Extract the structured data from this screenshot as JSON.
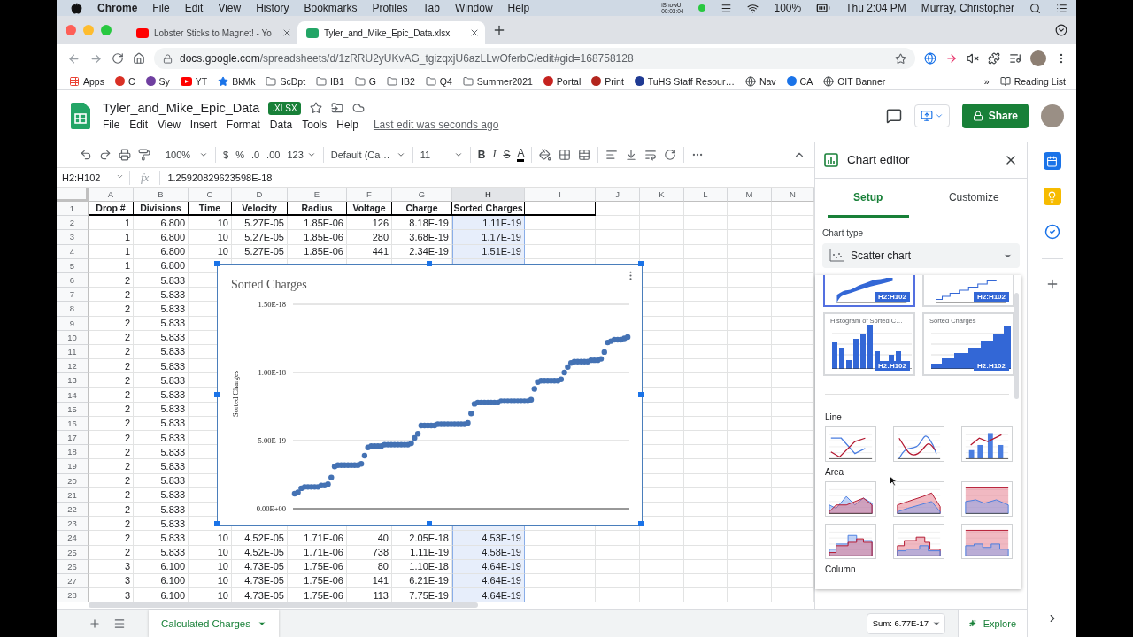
{
  "menubar": {
    "app": "Chrome",
    "items": [
      "File",
      "Edit",
      "View",
      "History",
      "Bookmarks",
      "Profiles",
      "Tab",
      "Window",
      "Help"
    ],
    "recorder": "iShowU",
    "recorder_time": "00:03:04",
    "battery": "100%",
    "clock": "Thu 2:04 PM",
    "user": "Murray, Christopher"
  },
  "browser_tabs": [
    {
      "title": "Lobster Sticks to Magnet! - Yo",
      "kind": "video",
      "selected": false
    },
    {
      "title": "Tyler_and_Mike_Epic_Data.xlsx",
      "kind": "sheet",
      "selected": true
    }
  ],
  "address": {
    "host": "docs.google.com",
    "path": "/spreadsheets/d/1zRRU2yUKvAG_tgizqxjU6azLLwOferbC/edit#gid=168758128"
  },
  "bookmarks": [
    {
      "kind": "apps",
      "label": "Apps"
    },
    {
      "kind": "site",
      "label": "C",
      "color": "#d93025"
    },
    {
      "kind": "site",
      "label": "Sy",
      "color": "#6f3fa0"
    },
    {
      "kind": "video",
      "label": "YT"
    },
    {
      "kind": "star",
      "label": "BkMk"
    },
    {
      "kind": "folder",
      "label": "ScDpt"
    },
    {
      "kind": "folder",
      "label": "IB1"
    },
    {
      "kind": "folder",
      "label": "G"
    },
    {
      "kind": "folder",
      "label": "IB2"
    },
    {
      "kind": "folder",
      "label": "Q4"
    },
    {
      "kind": "folder",
      "label": "Summer2021"
    },
    {
      "kind": "site",
      "label": "Portal",
      "color": "#c5221f"
    },
    {
      "kind": "site",
      "label": "Print",
      "color": "#b3261e"
    },
    {
      "kind": "site",
      "label": "TuHS Staff Resour…",
      "color": "#1f3a93"
    },
    {
      "kind": "globe",
      "label": "Nav"
    },
    {
      "kind": "site",
      "label": "CA",
      "color": "#1a73e8"
    },
    {
      "kind": "globe",
      "label": "OIT Banner"
    }
  ],
  "more_bookmarks": "»",
  "reading_list": "Reading List",
  "doc": {
    "title": "Tyler_and_Mike_Epic_Data",
    "badge": ".XLSX",
    "menu": [
      "File",
      "Edit",
      "View",
      "Insert",
      "Format",
      "Data",
      "Tools",
      "Help"
    ],
    "last_edit": "Last edit was seconds ago",
    "share": "Share"
  },
  "toolbar": {
    "zoom": "100%",
    "currency": "$",
    "percent": "%",
    "decrease_decimals": ".0",
    "increase_decimals": ".00",
    "number_format": "123",
    "font": "Default (Ca…",
    "font_size": "11",
    "bold": "B",
    "italic": "I",
    "strikethrough": "S",
    "text_color": "A"
  },
  "formula_bar": {
    "range": "H2:H102",
    "fx": "fx",
    "value": "1.25920829623598E-18"
  },
  "columns": [
    {
      "label": "A",
      "selected": false
    },
    {
      "label": "B",
      "selected": false
    },
    {
      "label": "C",
      "selected": false
    },
    {
      "label": "D",
      "selected": false
    },
    {
      "label": "E",
      "selected": false
    },
    {
      "label": "F",
      "selected": false
    },
    {
      "label": "G",
      "selected": false
    },
    {
      "label": "H",
      "selected": true
    },
    {
      "label": "I",
      "selected": false
    },
    {
      "label": "J",
      "selected": false
    },
    {
      "label": "K",
      "selected": false
    },
    {
      "label": "L",
      "selected": false
    },
    {
      "label": "M",
      "selected": false
    },
    {
      "label": "N",
      "selected": false
    }
  ],
  "rows": [
    {
      "n": "1",
      "kind": "header",
      "cells": [
        "Drop #",
        "Divisions",
        "Time",
        "Velocity",
        "Radius",
        "Voltage",
        "Charge",
        "Sorted Charges"
      ]
    },
    {
      "n": "2",
      "kind": "data",
      "cells": [
        "1",
        "6.800",
        "10",
        "5.27E-05",
        "1.85E-06",
        "126",
        "8.18E-19",
        "1.11E-19"
      ]
    },
    {
      "n": "3",
      "kind": "data",
      "cells": [
        "1",
        "6.800",
        "10",
        "5.27E-05",
        "1.85E-06",
        "280",
        "3.68E-19",
        "1.17E-19"
      ]
    },
    {
      "n": "4",
      "kind": "data",
      "cells": [
        "1",
        "6.800",
        "10",
        "5.27E-05",
        "1.85E-06",
        "441",
        "2.34E-19",
        "1.51E-19"
      ]
    },
    {
      "n": "5",
      "kind": "data",
      "cells": [
        "1",
        "6.800"
      ]
    },
    {
      "n": "6",
      "kind": "data",
      "cells": [
        "2",
        "5.833"
      ]
    },
    {
      "n": "7",
      "kind": "data",
      "cells": [
        "2",
        "5.833"
      ]
    },
    {
      "n": "8",
      "kind": "data",
      "cells": [
        "2",
        "5.833"
      ]
    },
    {
      "n": "9",
      "kind": "data",
      "cells": [
        "2",
        "5.833"
      ]
    },
    {
      "n": "10",
      "kind": "data",
      "cells": [
        "2",
        "5.833"
      ]
    },
    {
      "n": "11",
      "kind": "data",
      "cells": [
        "2",
        "5.833"
      ]
    },
    {
      "n": "12",
      "kind": "data",
      "cells": [
        "2",
        "5.833"
      ]
    },
    {
      "n": "13",
      "kind": "data",
      "cells": [
        "2",
        "5.833"
      ]
    },
    {
      "n": "14",
      "kind": "data",
      "cells": [
        "2",
        "5.833"
      ]
    },
    {
      "n": "15",
      "kind": "data",
      "cells": [
        "2",
        "5.833"
      ]
    },
    {
      "n": "16",
      "kind": "data",
      "cells": [
        "2",
        "5.833"
      ]
    },
    {
      "n": "17",
      "kind": "data",
      "cells": [
        "2",
        "5.833"
      ]
    },
    {
      "n": "18",
      "kind": "data",
      "cells": [
        "2",
        "5.833"
      ]
    },
    {
      "n": "19",
      "kind": "data",
      "cells": [
        "2",
        "5.833"
      ]
    },
    {
      "n": "20",
      "kind": "data",
      "cells": [
        "2",
        "5.833"
      ]
    },
    {
      "n": "21",
      "kind": "data",
      "cells": [
        "2",
        "5.833"
      ]
    },
    {
      "n": "22",
      "kind": "data",
      "cells": [
        "2",
        "5.833"
      ]
    },
    {
      "n": "23",
      "kind": "data",
      "cells": [
        "2",
        "5.833"
      ]
    },
    {
      "n": "24",
      "kind": "data",
      "cells": [
        "2",
        "5.833",
        "10",
        "4.52E-05",
        "1.71E-06",
        "40",
        "2.05E-18",
        "4.53E-19"
      ]
    },
    {
      "n": "25",
      "kind": "data",
      "cells": [
        "2",
        "5.833",
        "10",
        "4.52E-05",
        "1.71E-06",
        "738",
        "1.11E-19",
        "4.58E-19"
      ]
    },
    {
      "n": "26",
      "kind": "data",
      "cells": [
        "3",
        "6.100",
        "10",
        "4.73E-05",
        "1.75E-06",
        "80",
        "1.10E-18",
        "4.64E-19"
      ]
    },
    {
      "n": "27",
      "kind": "data",
      "cells": [
        "3",
        "6.100",
        "10",
        "4.73E-05",
        "1.75E-06",
        "141",
        "6.21E-19",
        "4.64E-19"
      ]
    },
    {
      "n": "28",
      "kind": "data",
      "cells": [
        "3",
        "6.100",
        "10",
        "4.73E-05",
        "1.75E-06",
        "113",
        "7.75E-19",
        "4.64E-19"
      ]
    }
  ],
  "chart": {
    "chart_data": {
      "type": "scatter",
      "title": "Sorted Charges",
      "ylabel": "Sorted Charges",
      "ylim": [
        0,
        1.5e-18
      ],
      "yticks": [
        {
          "value": 0,
          "label": "0.00E+00"
        },
        {
          "value": 5e-19,
          "label": "5.00E-19"
        },
        {
          "value": 1e-18,
          "label": "1.00E-18"
        },
        {
          "value": 1.5e-18,
          "label": "1.50E-18"
        }
      ],
      "categories": [
        null,
        null,
        null,
        null,
        null,
        null,
        null,
        null,
        null,
        null,
        null,
        null,
        null,
        null,
        null,
        null,
        null,
        null,
        null,
        null,
        null,
        null,
        null,
        null,
        null,
        null,
        null,
        null,
        null,
        null,
        null,
        null,
        null,
        null,
        null,
        null,
        null,
        null,
        null,
        null,
        null,
        null,
        null,
        null,
        null,
        null,
        null,
        null,
        null,
        null,
        null,
        null,
        null,
        null,
        null,
        null,
        null,
        null,
        null,
        null,
        null,
        null,
        null,
        null,
        null,
        null,
        null,
        null,
        null,
        null,
        null,
        null,
        null,
        null,
        null,
        null,
        null,
        null,
        null,
        null,
        null,
        null,
        null,
        null,
        null,
        null,
        null,
        null,
        null,
        null,
        null,
        null,
        null,
        null,
        null,
        null,
        null,
        null,
        null,
        null,
        null
      ],
      "series": [
        {
          "color": "#4472b4",
          "values": [
            1.1e-19,
            1.2e-19,
            1.5e-19,
            1.6e-19,
            1.6e-19,
            1.6e-19,
            1.6e-19,
            1.6e-19,
            1.7e-19,
            1.7e-19,
            1.8e-19,
            2.3e-19,
            3.1e-19,
            3.2e-19,
            3.2e-19,
            3.2e-19,
            3.2e-19,
            3.2e-19,
            3.2e-19,
            3.2e-19,
            3.3e-19,
            3.9e-19,
            4.5e-19,
            4.6e-19,
            4.6e-19,
            4.6e-19,
            4.6e-19,
            4.7e-19,
            4.7e-19,
            4.7e-19,
            4.7e-19,
            4.7e-19,
            4.7e-19,
            4.7e-19,
            4.7e-19,
            4.8e-19,
            5.2e-19,
            5.5e-19,
            6.1e-19,
            6.1e-19,
            6.1e-19,
            6.1e-19,
            6.1e-19,
            6.2e-19,
            6.2e-19,
            6.2e-19,
            6.2e-19,
            6.2e-19,
            6.2e-19,
            6.2e-19,
            6.2e-19,
            6.2e-19,
            6.3e-19,
            7e-19,
            7.7e-19,
            7.8e-19,
            7.8e-19,
            7.8e-19,
            7.8e-19,
            7.8e-19,
            7.8e-19,
            7.8e-19,
            7.9e-19,
            7.9e-19,
            7.9e-19,
            7.9e-19,
            7.9e-19,
            7.9e-19,
            7.9e-19,
            7.9e-19,
            7.9e-19,
            8e-19,
            8.8e-19,
            9.3e-19,
            9.4e-19,
            9.4e-19,
            9.4e-19,
            9.4e-19,
            9.4e-19,
            9.4e-19,
            9.5e-19,
            1e-18,
            1.04e-18,
            1.07e-18,
            1.08e-18,
            1.08e-18,
            1.08e-18,
            1.08e-18,
            1.08e-18,
            1.09e-18,
            1.09e-18,
            1.09e-18,
            1.1e-18,
            1.15e-18,
            1.22e-18,
            1.23e-18,
            1.24e-18,
            1.24e-18,
            1.24e-18,
            1.25e-18,
            1.26e-18
          ]
        }
      ]
    }
  },
  "sheet_tabs": [
    {
      "label": "Calculated Charges",
      "selected": true
    }
  ],
  "status": {
    "sum": "Sum: 6.77E-17",
    "explore": "Explore"
  },
  "chart_editor": {
    "title": "Chart editor",
    "tabs": [
      {
        "label": "Setup",
        "selected": true
      },
      {
        "label": "Customize",
        "selected": false
      }
    ],
    "chart_type_label": "Chart type",
    "chart_type": "Scatter chart",
    "suggestions": [
      {
        "kind": "area-step",
        "range": "H2:H102",
        "selected": true
      },
      {
        "kind": "line-step",
        "range": "H2:H102",
        "selected": false
      },
      {
        "kind": "histogram",
        "title": "Histogram of Sorted C…",
        "range": "H2:H102",
        "selected": false
      },
      {
        "kind": "column-step",
        "title": "Sorted Charges",
        "range": "H2:H102",
        "selected": false
      }
    ],
    "groups": [
      {
        "label": "Line",
        "types": [
          {
            "kind": "line"
          },
          {
            "kind": "smooth"
          },
          {
            "kind": "combo"
          }
        ]
      },
      {
        "label": "Area",
        "types": [
          {
            "kind": "area"
          },
          {
            "kind": "stacked-area"
          },
          {
            "kind": "full-area"
          },
          {
            "kind": "stepped-area"
          },
          {
            "kind": "stacked-stepped"
          },
          {
            "kind": "full-stepped"
          }
        ]
      },
      {
        "label": "Column"
      }
    ]
  }
}
